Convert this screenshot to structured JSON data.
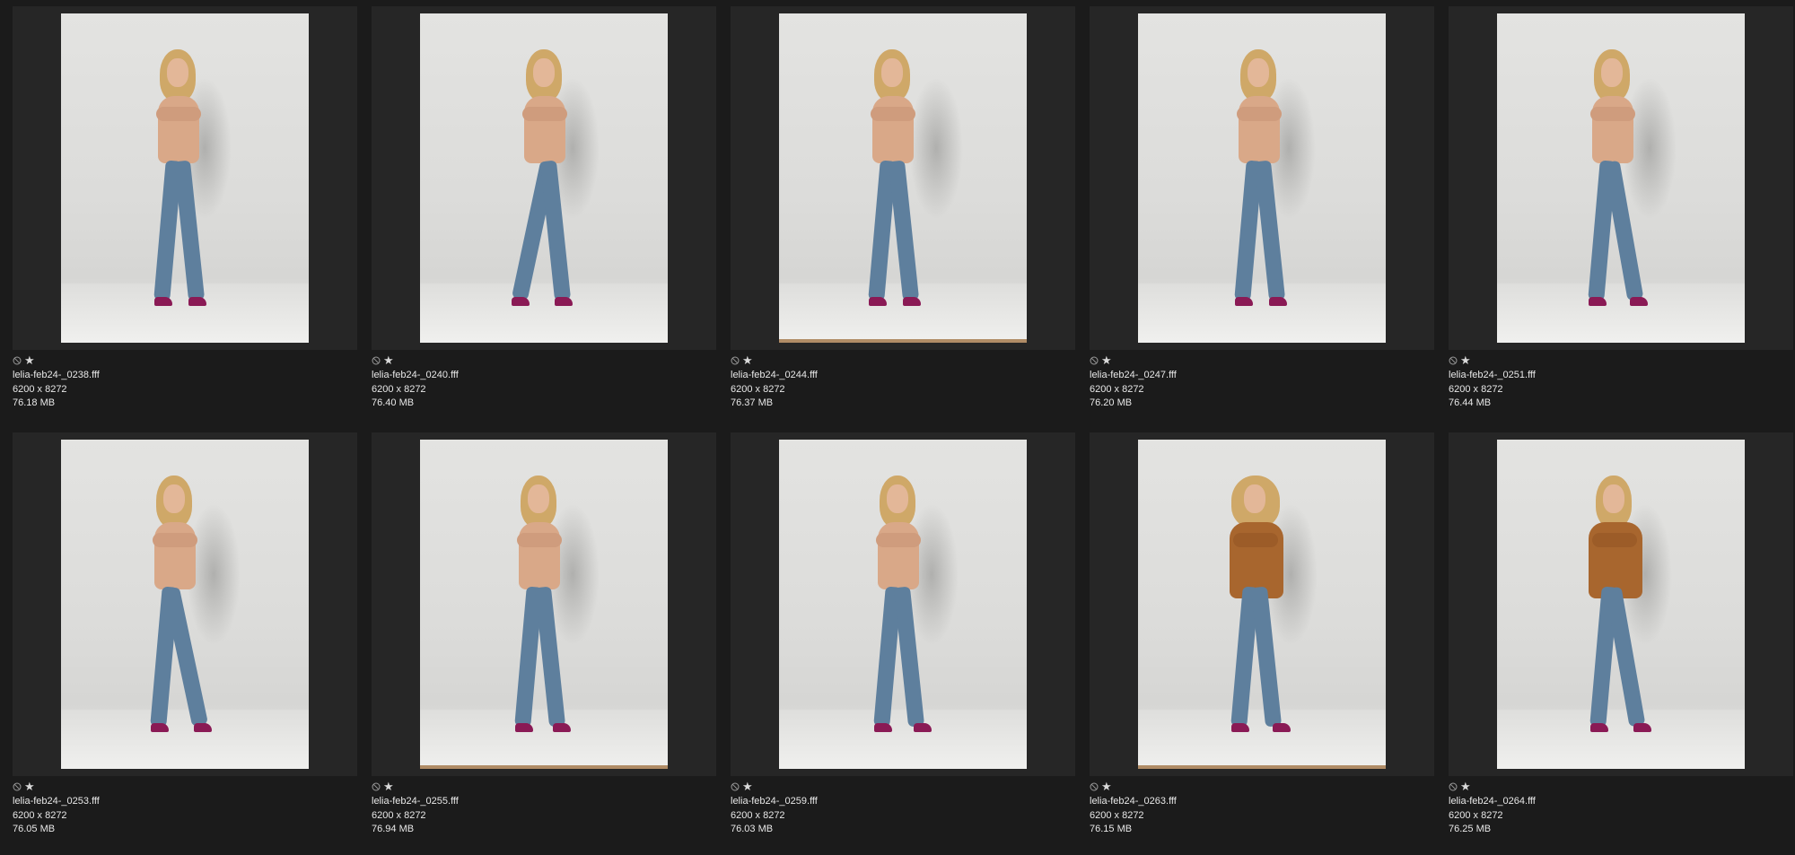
{
  "thumbnails": [
    {
      "filename": "lelia-feb24-_0238.fff",
      "dimensions": "6200 x 8272",
      "size": "76.18 MB",
      "wardrobe": "topless",
      "floor": "plain"
    },
    {
      "filename": "lelia-feb24-_0240.fff",
      "dimensions": "6200 x 8272",
      "size": "76.40 MB",
      "wardrobe": "topless",
      "floor": "plain"
    },
    {
      "filename": "lelia-feb24-_0244.fff",
      "dimensions": "6200 x 8272",
      "size": "76.37 MB",
      "wardrobe": "topless",
      "floor": "wood"
    },
    {
      "filename": "lelia-feb24-_0247.fff",
      "dimensions": "6200 x 8272",
      "size": "76.20 MB",
      "wardrobe": "topless",
      "floor": "plain"
    },
    {
      "filename": "lelia-feb24-_0251.fff",
      "dimensions": "6200 x 8272",
      "size": "76.44 MB",
      "wardrobe": "topless",
      "floor": "plain"
    },
    {
      "filename": "lelia-feb24-_0253.fff",
      "dimensions": "6200 x 8272",
      "size": "76.05 MB",
      "wardrobe": "topless",
      "floor": "plain"
    },
    {
      "filename": "lelia-feb24-_0255.fff",
      "dimensions": "6200 x 8272",
      "size": "76.94 MB",
      "wardrobe": "topless",
      "floor": "wood"
    },
    {
      "filename": "lelia-feb24-_0259.fff",
      "dimensions": "6200 x 8272",
      "size": "76.03 MB",
      "wardrobe": "topless",
      "floor": "plain"
    },
    {
      "filename": "lelia-feb24-_0263.fff",
      "dimensions": "6200 x 8272",
      "size": "76.15 MB",
      "wardrobe": "jacket",
      "floor": "wood"
    },
    {
      "filename": "lelia-feb24-_0264.fff",
      "dimensions": "6200 x 8272",
      "size": "76.25 MB",
      "wardrobe": "jacket",
      "floor": "plain"
    }
  ],
  "icons": {
    "reject": "reject-flag-icon",
    "rating": "star-icon"
  },
  "colors": {
    "background": "#1b1b1b",
    "thumbnail_frame": "#262626",
    "text": "#e8e8e8"
  }
}
